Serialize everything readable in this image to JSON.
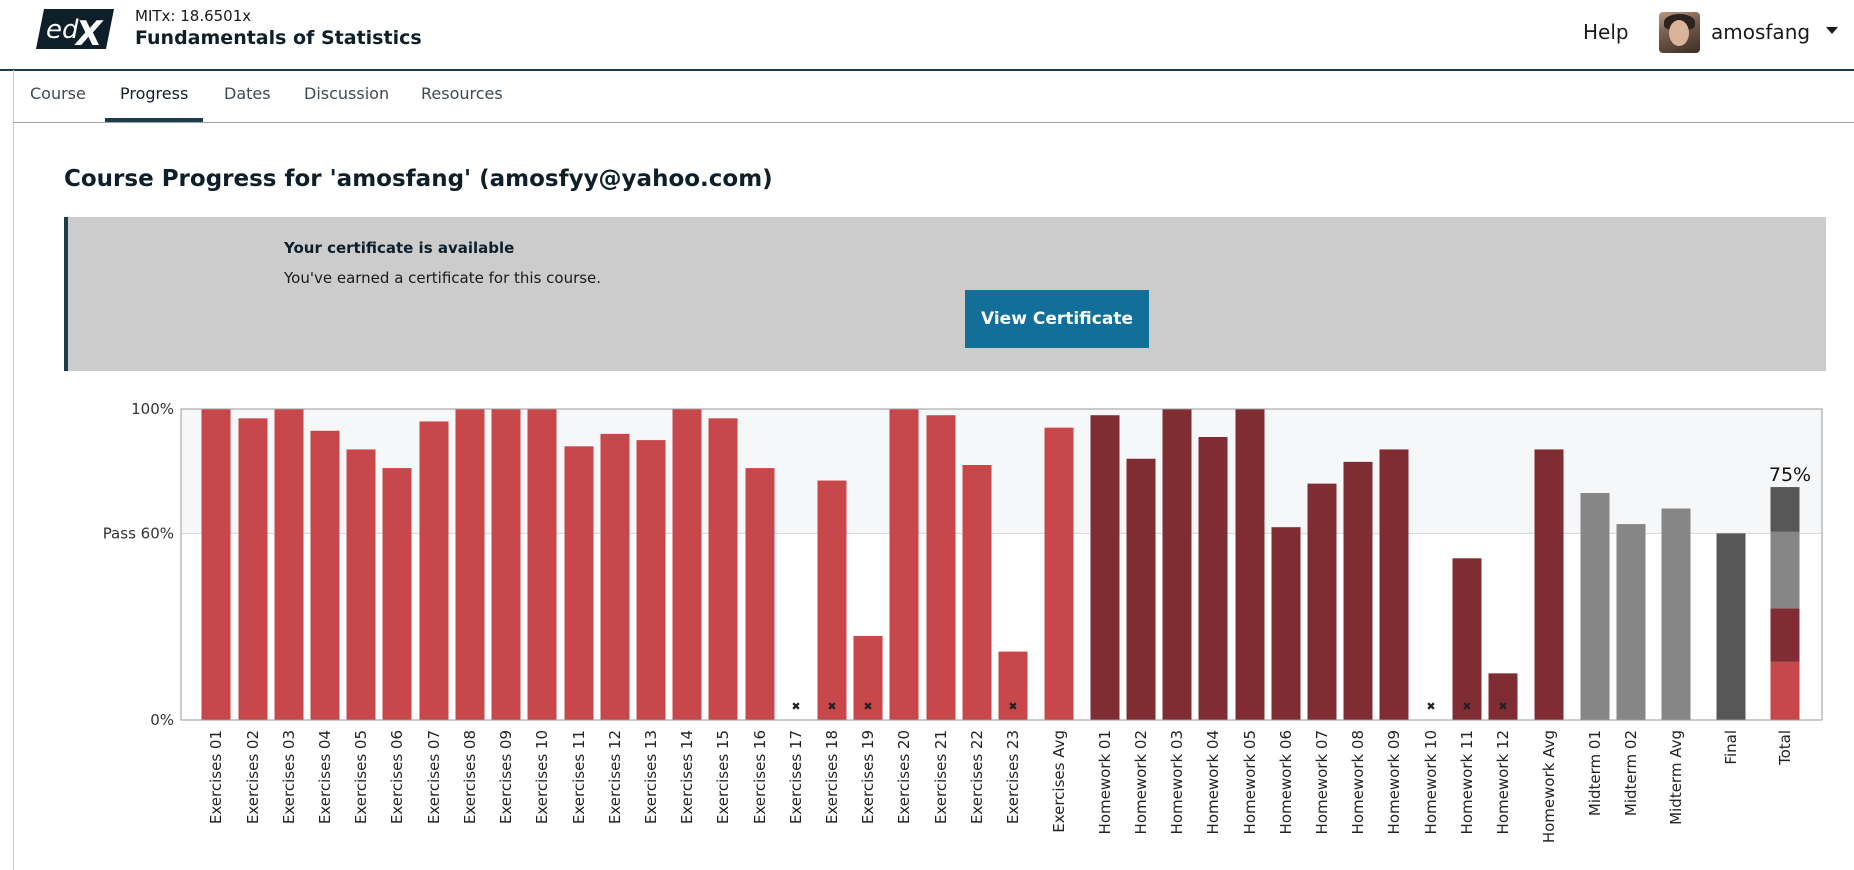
{
  "header": {
    "logo_text": "edX",
    "course_org": "MITx: 18.6501x",
    "course_name": "Fundamentals of Statistics",
    "help_label": "Help",
    "username": "amosfang"
  },
  "tabs": [
    {
      "label": "Course",
      "active": false
    },
    {
      "label": "Progress",
      "active": true
    },
    {
      "label": "Dates",
      "active": false
    },
    {
      "label": "Discussion",
      "active": false
    },
    {
      "label": "Resources",
      "active": false
    }
  ],
  "page_title": "Course Progress for 'amosfang' (amosfyy@yahoo.com)",
  "certificate": {
    "heading": "Your certificate is available",
    "text": "You've earned a certificate for this course.",
    "button_label": "View Certificate"
  },
  "colors": {
    "exercises": "#c7474b",
    "homework": "#7f2d33",
    "midterm": "#868686",
    "final": "#575757",
    "brand": "#126f9a",
    "header_rule": "#1c3b4b"
  },
  "chart_data": {
    "type": "bar",
    "ylabels": [
      "100%",
      "Pass 60%",
      "0%"
    ],
    "yticks": [
      100,
      60,
      0
    ],
    "ylim": [
      0,
      100
    ],
    "pass_threshold": 60,
    "total_label": "75%",
    "total_segments": [
      {
        "group": "exercises",
        "value": 18.7
      },
      {
        "group": "homework",
        "value": 17.2
      },
      {
        "group": "midterm",
        "value": 24.6
      },
      {
        "group": "final",
        "value": 14.4
      }
    ],
    "bars": [
      {
        "label": "Exercises 01",
        "value": 100,
        "group": "exercises",
        "dropped": false
      },
      {
        "label": "Exercises 02",
        "value": 97,
        "group": "exercises",
        "dropped": false
      },
      {
        "label": "Exercises 03",
        "value": 100,
        "group": "exercises",
        "dropped": false
      },
      {
        "label": "Exercises 04",
        "value": 93,
        "group": "exercises",
        "dropped": false
      },
      {
        "label": "Exercises 05",
        "value": 87,
        "group": "exercises",
        "dropped": false
      },
      {
        "label": "Exercises 06",
        "value": 81,
        "group": "exercises",
        "dropped": false
      },
      {
        "label": "Exercises 07",
        "value": 96,
        "group": "exercises",
        "dropped": false
      },
      {
        "label": "Exercises 08",
        "value": 100,
        "group": "exercises",
        "dropped": false
      },
      {
        "label": "Exercises 09",
        "value": 100,
        "group": "exercises",
        "dropped": false
      },
      {
        "label": "Exercises 10",
        "value": 100,
        "group": "exercises",
        "dropped": false
      },
      {
        "label": "Exercises 11",
        "value": 88,
        "group": "exercises",
        "dropped": false
      },
      {
        "label": "Exercises 12",
        "value": 92,
        "group": "exercises",
        "dropped": false
      },
      {
        "label": "Exercises 13",
        "value": 90,
        "group": "exercises",
        "dropped": false
      },
      {
        "label": "Exercises 14",
        "value": 100,
        "group": "exercises",
        "dropped": false
      },
      {
        "label": "Exercises 15",
        "value": 97,
        "group": "exercises",
        "dropped": false
      },
      {
        "label": "Exercises 16",
        "value": 81,
        "group": "exercises",
        "dropped": false
      },
      {
        "label": "Exercises 17",
        "value": 0,
        "group": "exercises",
        "dropped": true
      },
      {
        "label": "Exercises 18",
        "value": 77,
        "group": "exercises",
        "dropped": true
      },
      {
        "label": "Exercises 19",
        "value": 27,
        "group": "exercises",
        "dropped": true
      },
      {
        "label": "Exercises 20",
        "value": 100,
        "group": "exercises",
        "dropped": false
      },
      {
        "label": "Exercises 21",
        "value": 98,
        "group": "exercises",
        "dropped": false
      },
      {
        "label": "Exercises 22",
        "value": 82,
        "group": "exercises",
        "dropped": false
      },
      {
        "label": "Exercises 23",
        "value": 22,
        "group": "exercises",
        "dropped": true
      },
      {
        "label": "Exercises Avg",
        "value": 94,
        "group": "exercises",
        "dropped": false
      },
      {
        "label": "Homework 01",
        "value": 98,
        "group": "homework",
        "dropped": false
      },
      {
        "label": "Homework 02",
        "value": 84,
        "group": "homework",
        "dropped": false
      },
      {
        "label": "Homework 03",
        "value": 100,
        "group": "homework",
        "dropped": false
      },
      {
        "label": "Homework 04",
        "value": 91,
        "group": "homework",
        "dropped": false
      },
      {
        "label": "Homework 05",
        "value": 100,
        "group": "homework",
        "dropped": false
      },
      {
        "label": "Homework 06",
        "value": 62,
        "group": "homework",
        "dropped": false
      },
      {
        "label": "Homework 07",
        "value": 76,
        "group": "homework",
        "dropped": false
      },
      {
        "label": "Homework 08",
        "value": 83,
        "group": "homework",
        "dropped": false
      },
      {
        "label": "Homework 09",
        "value": 87,
        "group": "homework",
        "dropped": false
      },
      {
        "label": "Homework 10",
        "value": 0,
        "group": "homework",
        "dropped": true
      },
      {
        "label": "Homework 11",
        "value": 52,
        "group": "homework",
        "dropped": true
      },
      {
        "label": "Homework 12",
        "value": 15,
        "group": "homework",
        "dropped": true
      },
      {
        "label": "Homework Avg",
        "value": 87,
        "group": "homework",
        "dropped": false
      },
      {
        "label": "Midterm 01",
        "value": 73,
        "group": "midterm",
        "dropped": false
      },
      {
        "label": "Midterm 02",
        "value": 63,
        "group": "midterm",
        "dropped": false
      },
      {
        "label": "Midterm Avg",
        "value": 68,
        "group": "midterm",
        "dropped": false
      },
      {
        "label": "Final",
        "value": 60,
        "group": "final",
        "dropped": false
      },
      {
        "label": "Total",
        "value": 75,
        "group": "total",
        "dropped": false
      }
    ]
  }
}
